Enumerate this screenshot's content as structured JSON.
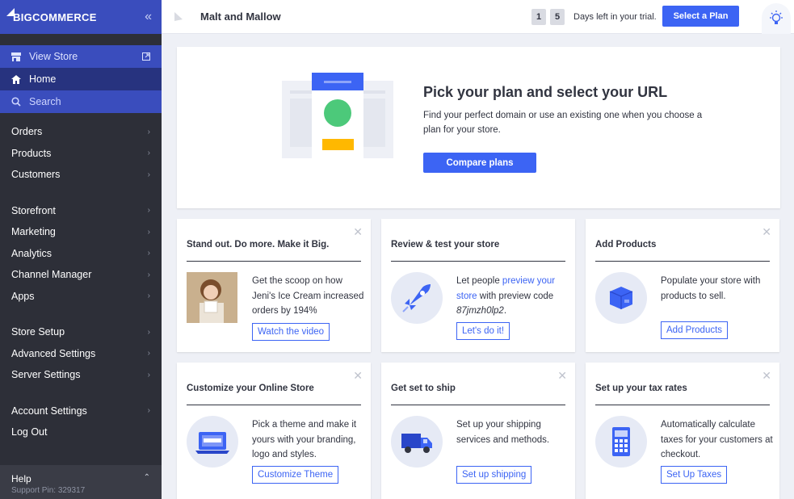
{
  "sidebar": {
    "logo_prefix": "BIG",
    "logo_suffix": "COMMERCE",
    "collapse_icon": "«",
    "view_store": "View Store",
    "home": "Home",
    "search": "Search",
    "group1": [
      "Orders",
      "Products",
      "Customers"
    ],
    "group2": [
      "Storefront",
      "Marketing",
      "Analytics",
      "Channel Manager",
      "Apps"
    ],
    "group3": [
      "Store Setup",
      "Advanced Settings",
      "Server Settings"
    ],
    "group4": [
      "Account Settings",
      "Log Out"
    ],
    "help": "Help",
    "support_pin": "Support Pin: 329317"
  },
  "topbar": {
    "store_name": "Malt and Mallow",
    "trial_days": [
      "1",
      "5"
    ],
    "trial_text": "Days left in your trial.",
    "select_plan": "Select a Plan"
  },
  "hero": {
    "title": "Pick your plan and select your URL",
    "description": "Find your perfect domain or use an existing one when you choose a plan for your store.",
    "button": "Compare plans"
  },
  "cards": [
    {
      "title": "Stand out. Do more. Make it Big.",
      "text_plain": "Get the scoop on how Jeni's Ice Cream increased orders by 194%",
      "button": "Watch the video"
    },
    {
      "title": "Review & test your store",
      "text_a": "Let people ",
      "text_link": "preview your store",
      "text_b": " with preview code ",
      "text_code": "87jmzh0lp2",
      "text_c": ".",
      "button": "Let's do it!"
    },
    {
      "title": "Add Products",
      "text_plain": "Populate your store with products to sell.",
      "button": "Add Products"
    },
    {
      "title": "Customize your Online Store",
      "text_plain": "Pick a theme and make it yours with your branding, logo and styles.",
      "button": "Customize Theme"
    },
    {
      "title": "Get set to ship",
      "text_plain": "Set up your shipping services and methods.",
      "button": "Set up shipping"
    },
    {
      "title": "Set up your tax rates",
      "text_plain": "Automatically calculate taxes for your customers at checkout.",
      "button": "Set Up Taxes"
    }
  ],
  "colors": {
    "accent": "#3c64f4",
    "sidebar": "#2d2f38",
    "sidebar_active": "#27337f",
    "sidebar_header": "#3a4dbd"
  }
}
